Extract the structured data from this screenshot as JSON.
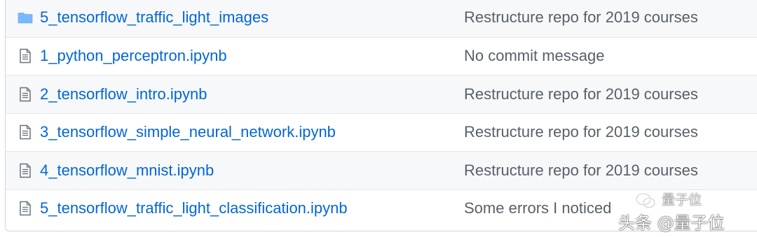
{
  "rows": [
    {
      "type": "folder",
      "icon": "folder-icon",
      "name": "5_tensorflow_traffic_light_images",
      "message": "Restructure repo for 2019 courses"
    },
    {
      "type": "file",
      "icon": "file-icon",
      "name": "1_python_perceptron.ipynb",
      "message": "No commit message"
    },
    {
      "type": "file",
      "icon": "file-icon",
      "name": "2_tensorflow_intro.ipynb",
      "message": "Restructure repo for 2019 courses"
    },
    {
      "type": "file",
      "icon": "file-icon",
      "name": "3_tensorflow_simple_neural_network.ipynb",
      "message": "Restructure repo for 2019 courses"
    },
    {
      "type": "file",
      "icon": "file-icon",
      "name": "4_tensorflow_mnist.ipynb",
      "message": "Restructure repo for 2019 courses"
    },
    {
      "type": "file",
      "icon": "file-icon",
      "name": "5_tensorflow_traffic_light_classification.ipynb",
      "message": "Some errors I noticed"
    }
  ],
  "watermark": {
    "account_small": "量子位",
    "account_big": "头条 @量子位"
  },
  "colors": {
    "link": "#0366d6",
    "message": "#586069",
    "icon": "#6a737d",
    "folder": "#79b8ff"
  }
}
